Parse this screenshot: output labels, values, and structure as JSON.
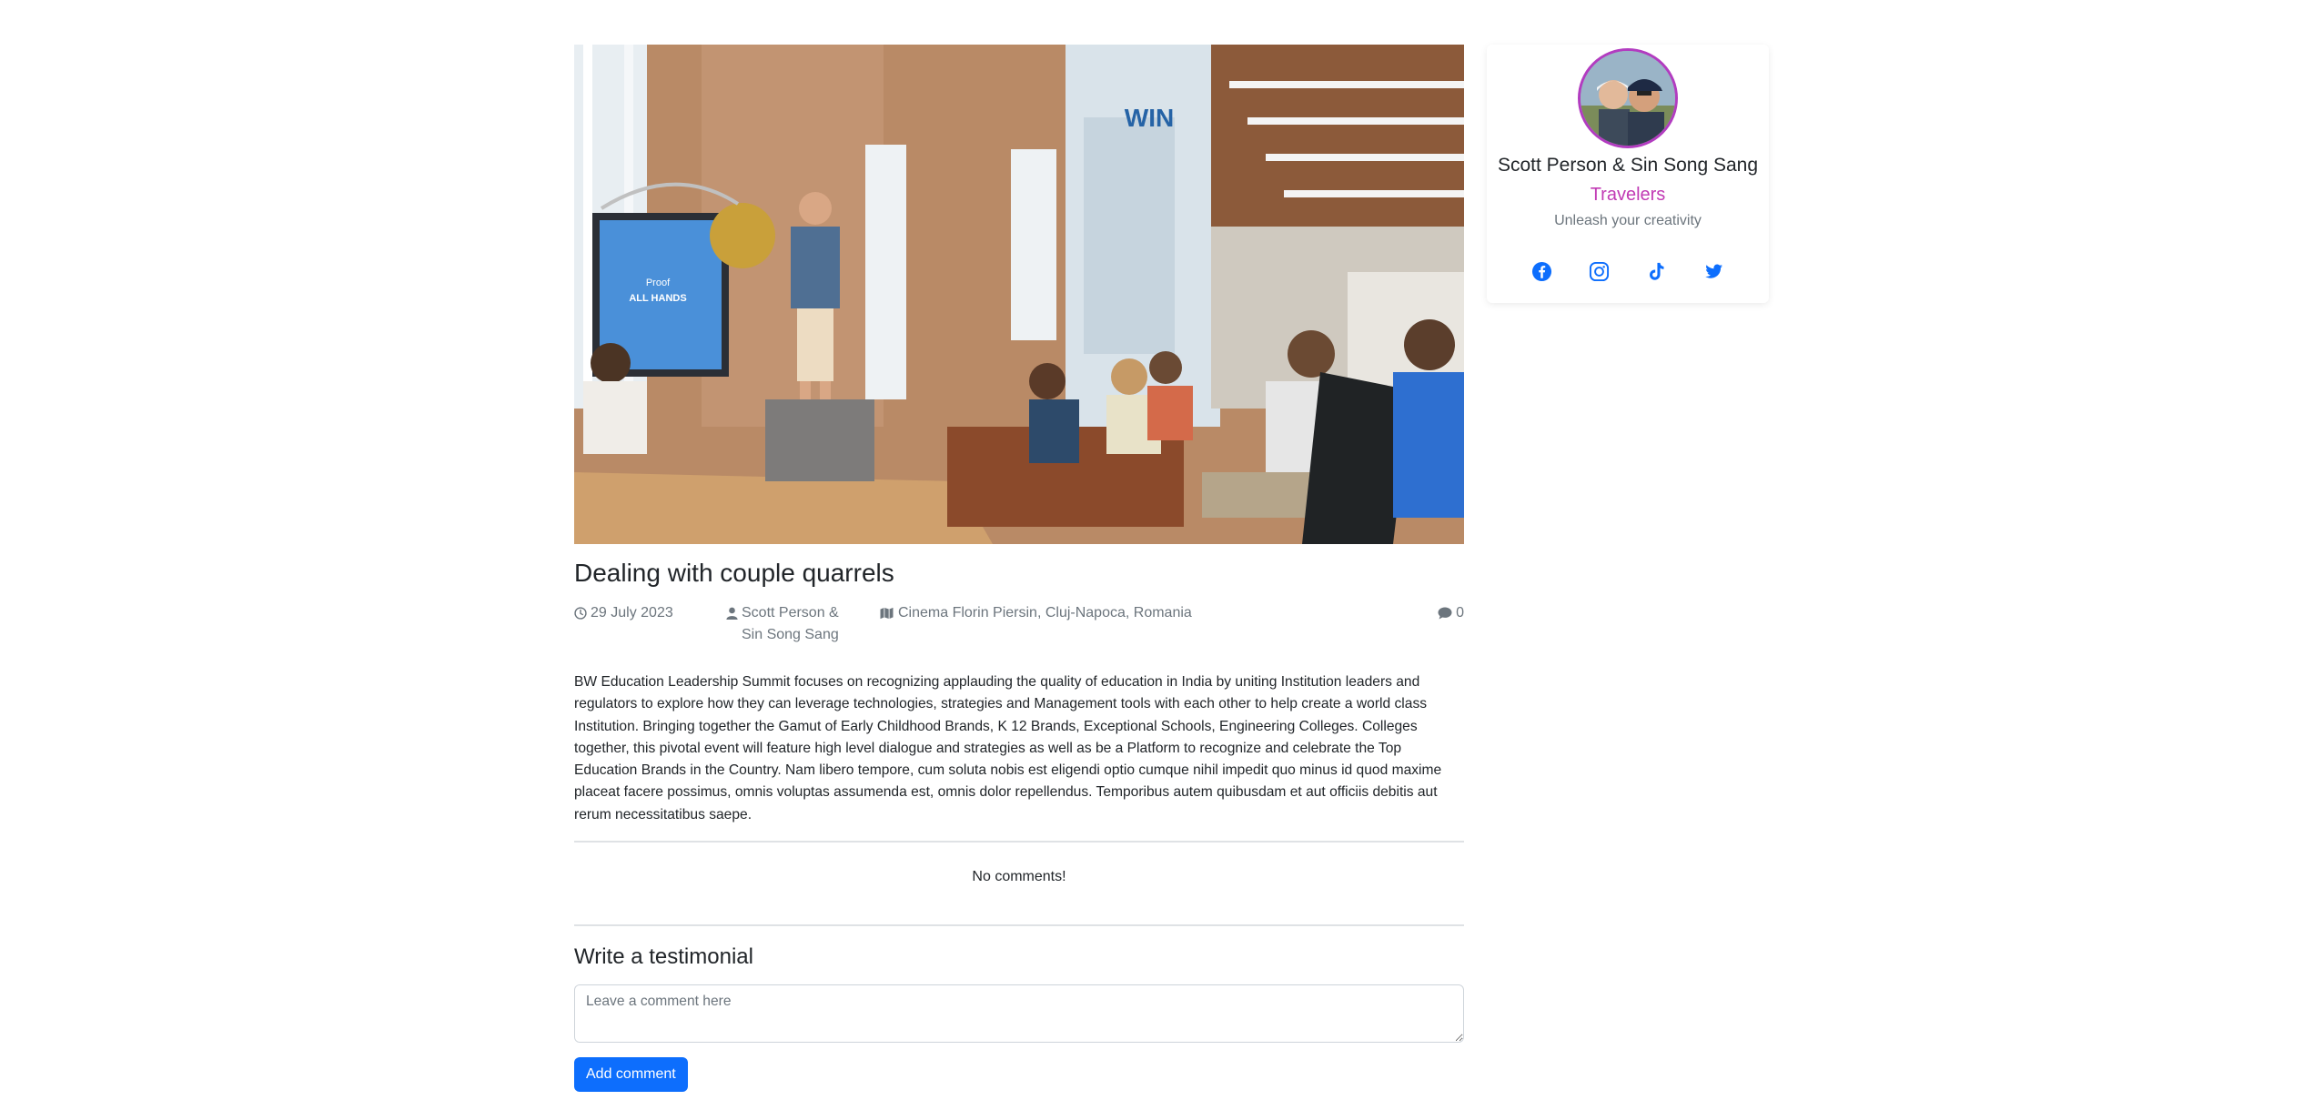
{
  "article": {
    "title": "Dealing with couple quarrels",
    "date": "29 July 2023",
    "author": "Scott Person & Sin Song Sang",
    "location": "Cinema Florin Piersin, Cluj-Napoca, Romania",
    "comment_count": "0",
    "body": "BW Education Leadership Summit focuses on recognizing applauding the quality of education in India by uniting Institution leaders and regulators to explore how they can leverage technologies, strategies and Management tools with each other to help create a world class Institution. Bringing together the Gamut of Early Childhood Brands, K 12 Brands, Exceptional Schools, Engineering Colleges. Colleges together, this pivotal event will feature high level dialogue and strategies as well as be a Platform to recognize and celebrate the Top Education Brands in the Country. Nam libero tempore, cum soluta nobis est eligendi optio cumque nihil impedit quo minus id quod maxime placeat facere possimus, omnis voluptas assumenda est, omnis dolor repellendus. Temporibus autem quibusdam et aut officiis debitis aut rerum necessitatibus saepe.",
    "image_text": {
      "screen_line1": "Proof",
      "screen_line2": "ALL HANDS",
      "wall_sign": "WIN"
    }
  },
  "comments": {
    "empty_message": "No comments!"
  },
  "testimonial": {
    "heading": "Write a testimonial",
    "placeholder": "Leave a comment here",
    "submit_label": "Add comment"
  },
  "profile": {
    "name": "Scott Person & Sin Song Sang",
    "role": "Travelers",
    "tagline": "Unleash your creativity",
    "socials": [
      "facebook-icon",
      "instagram-icon",
      "tiktok-icon",
      "twitter-icon"
    ]
  },
  "colors": {
    "accent": "#0d6efd",
    "role": "#c13ab4",
    "avatar_border": "#b23cc0",
    "muted": "#6c757d"
  },
  "icons": {
    "date": "clock-icon",
    "author": "user-icon",
    "location": "map-icon",
    "comments": "comment-icon"
  }
}
